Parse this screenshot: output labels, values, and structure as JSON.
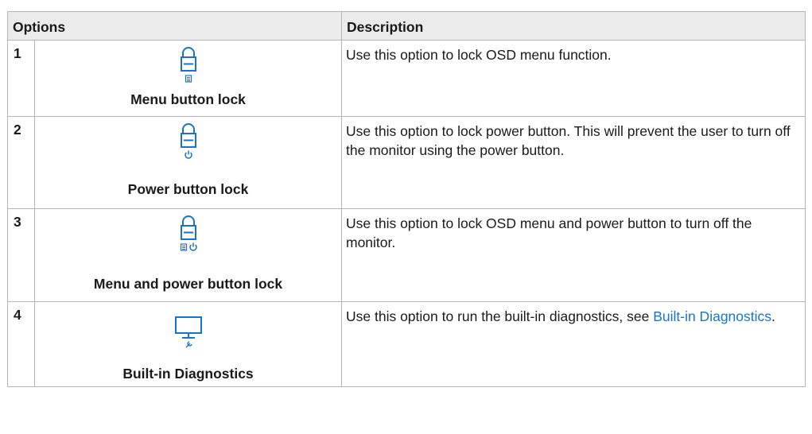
{
  "headers": {
    "options": "Options",
    "description": "Description"
  },
  "rows": [
    {
      "num": "1",
      "icon": "menu-button-lock-icon",
      "label": "Menu button lock",
      "desc": "Use this option to lock OSD menu function."
    },
    {
      "num": "2",
      "icon": "power-button-lock-icon",
      "label": "Power button lock",
      "desc": "Use this option to lock power button. This will prevent the user to turn off the monitor using the power button."
    },
    {
      "num": "3",
      "icon": "menu-and-power-button-lock-icon",
      "label": "Menu and power button lock",
      "desc": "Use this option to lock OSD menu and power button to turn off the monitor."
    },
    {
      "num": "4",
      "icon": "built-in-diagnostics-icon",
      "label": "Built-in Diagnostics",
      "desc_prefix": "Use this option to run the built-in  diagnostics, see ",
      "desc_link": "Built-in Diagnostics",
      "desc_suffix": "."
    }
  ],
  "colors": {
    "icon": "#1a73c8",
    "link": "#1a73c8",
    "header_bg": "#ebebeb",
    "border": "#b5b5b5"
  }
}
